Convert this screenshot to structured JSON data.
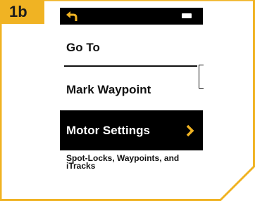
{
  "step": {
    "label": "1b"
  },
  "status_bar": {
    "back_icon": "back-arrow-icon",
    "battery_icon": "battery-icon"
  },
  "menu": {
    "items": [
      {
        "label": "Go To"
      },
      {
        "label": "Mark Waypoint"
      },
      {
        "label": "Motor Settings",
        "selected": true,
        "chevron_icon": "chevron-right-icon"
      }
    ],
    "selected_description": "Spot-Locks, Waypoints, and iTracks"
  },
  "colors": {
    "badge": "#f0b323",
    "frame_border": "#f0b323",
    "selected_background": "#000000",
    "selected_text": "#ffffff",
    "chevron": "#f0b323"
  }
}
